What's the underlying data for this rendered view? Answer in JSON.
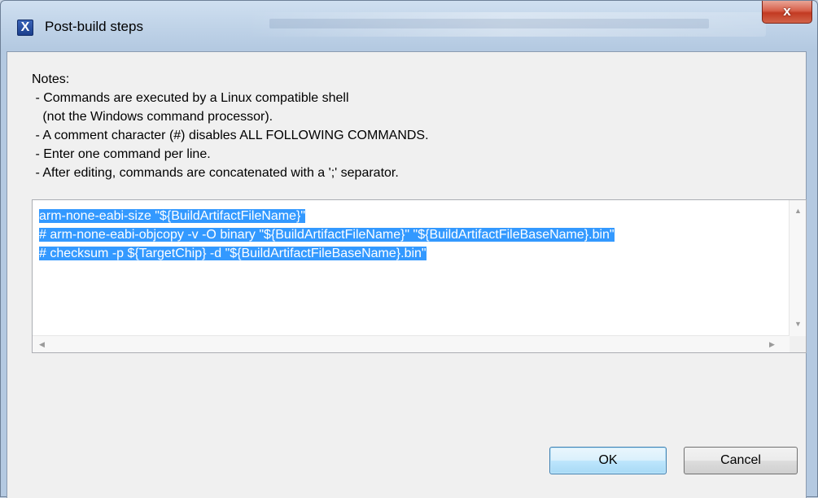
{
  "window": {
    "title": "Post-build steps",
    "app_icon_glyph": "X",
    "close_glyph": "x"
  },
  "notes": {
    "heading": "Notes:",
    "lines": [
      " - Commands are executed by a Linux compatible shell",
      "   (not the Windows command processor).",
      " - A comment character (#) disables ALL FOLLOWING COMMANDS.",
      " - Enter one command per line.",
      " - After editing, commands are concatenated with a ';' separator."
    ]
  },
  "editor": {
    "lines": [
      "arm-none-eabi-size \"${BuildArtifactFileName}\"",
      "# arm-none-eabi-objcopy -v -O binary \"${BuildArtifactFileName}\" \"${BuildArtifactFileBaseName}.bin\"",
      "# checksum -p ${TargetChip} -d \"${BuildArtifactFileBaseName}.bin\""
    ],
    "selection_color": "#3399ff"
  },
  "buttons": {
    "ok": "OK",
    "cancel": "Cancel"
  },
  "icons": {
    "app": "app-x-icon",
    "close": "close-icon",
    "scroll_up": "scroll-up-arrow-icon",
    "scroll_down": "scroll-down-arrow-icon",
    "scroll_left": "scroll-left-arrow-icon",
    "scroll_right": "scroll-right-arrow-icon"
  }
}
